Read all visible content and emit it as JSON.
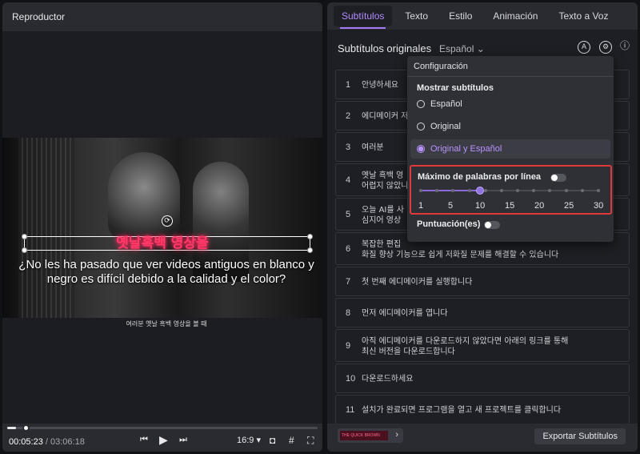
{
  "player": {
    "title": "Reproductor",
    "overlay_title": "옛날흑백 영상을",
    "subtitle_spanish": "¿No les ha pasado que ver videos antiguos en blanco y negro es difícil debido a la calidad y el color?",
    "subtitle_korean": "여러분 옛날 흑백 영상을 볼 때",
    "current_time": "00:05:23",
    "separator": " / ",
    "duration": "03:06:18",
    "progress": 0.029,
    "aspect_ratio": "16:9"
  },
  "panel": {
    "tabs": [
      {
        "label": "Subtítulos",
        "active": true
      },
      {
        "label": "Texto",
        "active": false
      },
      {
        "label": "Estilo",
        "active": false
      },
      {
        "label": "Animación",
        "active": false
      },
      {
        "label": "Texto a Voz",
        "active": false
      }
    ],
    "original_label": "Subtítulos originales",
    "language": "Español",
    "rows": [
      {
        "num": "1",
        "text": "안녕하세요"
      },
      {
        "num": "2",
        "text": "에디메이커 저"
      },
      {
        "num": "3",
        "text": "여러분"
      },
      {
        "num": "4",
        "text": "옛날 흑백 영\n어렵지 않았니"
      },
      {
        "num": "5",
        "text": "오늘 AI를 사\n심지어 영상"
      },
      {
        "num": "6",
        "text": "복잡한 편집\n화질 향상 기능으로 쉽게 저화질 문제를 해결할 수 있습니다"
      },
      {
        "num": "7",
        "text": "첫 번째 에디메이커를 실행합니다"
      },
      {
        "num": "8",
        "text": "먼저 에디메이커를 엽니다"
      },
      {
        "num": "9",
        "text": "아직 에디메이커를 다운로드하지 않았다면 아래의 링크를 통해\n최신 버전을 다운로드합니다"
      },
      {
        "num": "10",
        "text": "다운로드하세요"
      },
      {
        "num": "11",
        "text": "설치가 완료되면 프로그램을 열고 새 프로젝트를 클릭합니다"
      }
    ],
    "style_preview_text": "THE QUICK BROWN",
    "export_label": "Exportar Subtítulos"
  },
  "settings": {
    "title": "Configuración",
    "show_label": "Mostrar subtítulos",
    "options": [
      {
        "label": "Español",
        "selected": false
      },
      {
        "label": "Original",
        "selected": false
      },
      {
        "label": "Original y Español",
        "selected": true
      }
    ],
    "max_words_label": "Máximo de palabras por línea",
    "max_words_enabled": false,
    "slider_value": 10,
    "slider_min": 1,
    "slider_max": 30,
    "slider_ticks": [
      "1",
      "5",
      "10",
      "15",
      "20",
      "25",
      "30"
    ],
    "punctuation_label": "Puntuación(es)",
    "punctuation_enabled": false
  },
  "colors": {
    "accent": "#a27bf5",
    "highlight_border": "#e0393b",
    "panel_bg": "#1e1f24"
  }
}
